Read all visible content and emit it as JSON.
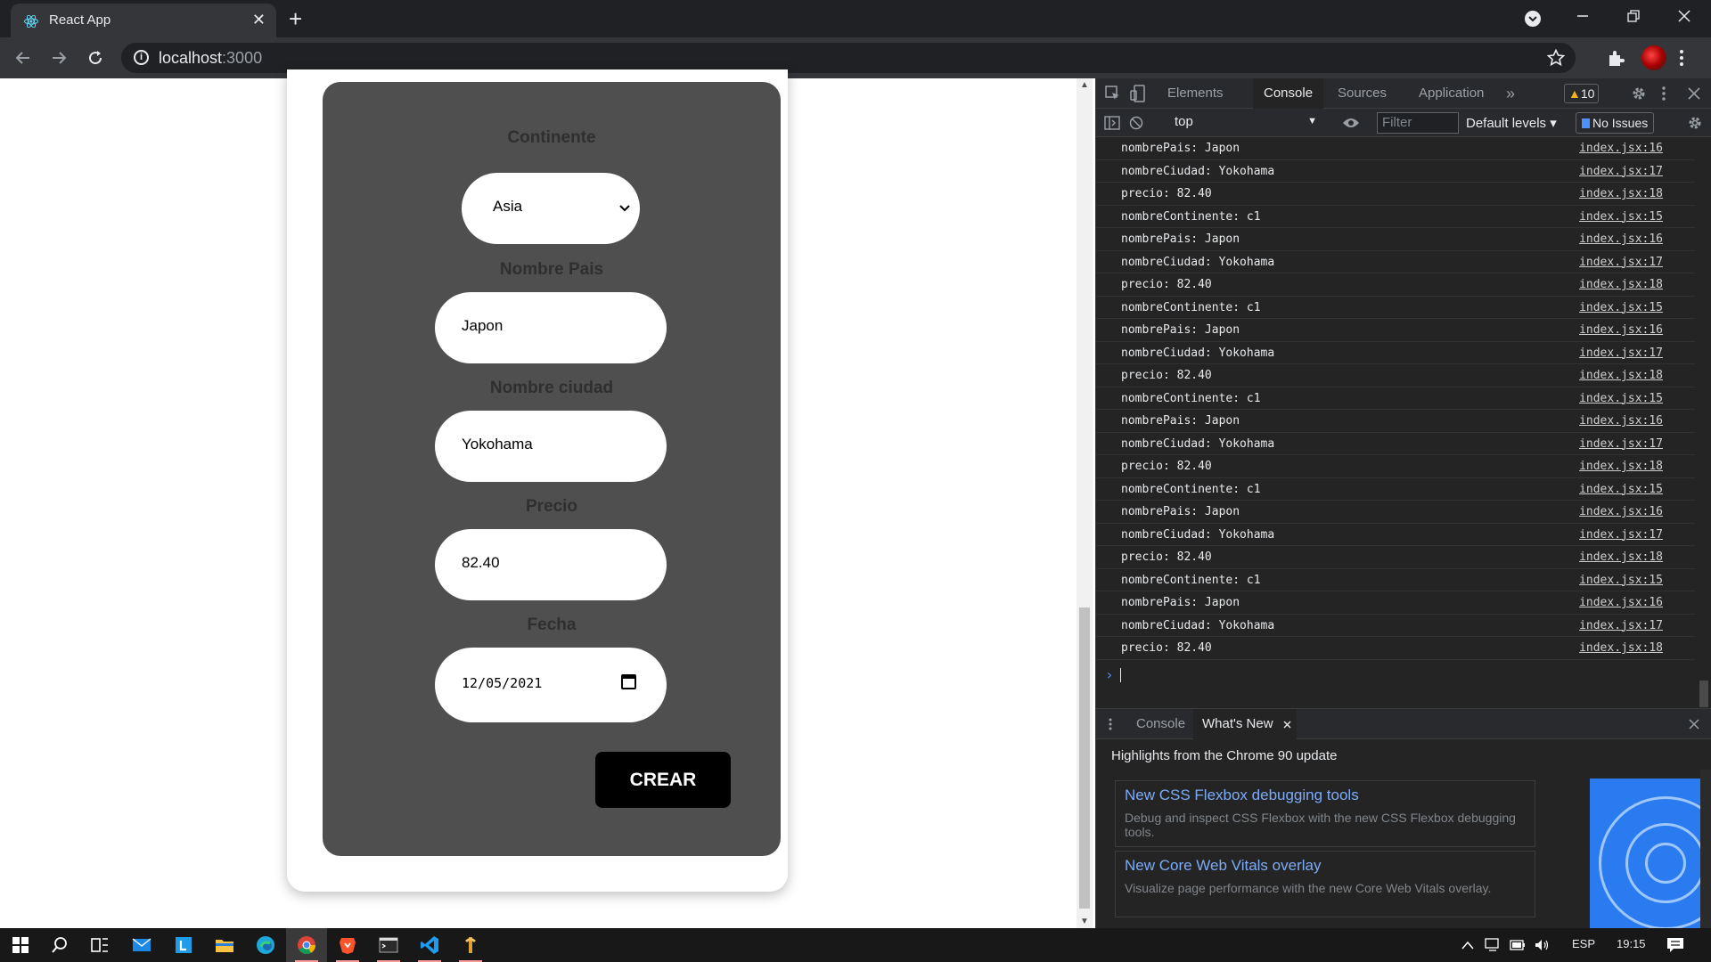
{
  "browser": {
    "tab_title": "React App",
    "tab_close": "✕",
    "new_tab": "+",
    "url_host": "localhost",
    "url_port": ":3000"
  },
  "form": {
    "continente_label": "Continente",
    "continente_value": "Asia",
    "nombre_pais_label": "Nombre Pais",
    "nombre_pais_value": "Japon",
    "nombre_ciudad_label": "Nombre ciudad",
    "nombre_ciudad_value": "Yokohama",
    "precio_label": "Precio",
    "precio_value": "82.40",
    "fecha_label": "Fecha",
    "fecha_value": "12/05/2021",
    "submit_label": "CREAR"
  },
  "devtools": {
    "tabs": [
      "Elements",
      "Console",
      "Sources",
      "Application"
    ],
    "more": "»",
    "warnings": "10",
    "context": "top",
    "filter_placeholder": "Filter",
    "levels": "Default levels",
    "issues": "No Issues",
    "log": [
      {
        "msg": "nombrePais: Japon",
        "src": "index.jsx:16"
      },
      {
        "msg": "nombreCiudad: Yokohama",
        "src": "index.jsx:17"
      },
      {
        "msg": "precio: 82.40",
        "src": "index.jsx:18"
      },
      {
        "msg": "nombreContinente: c1",
        "src": "index.jsx:15"
      },
      {
        "msg": "nombrePais: Japon",
        "src": "index.jsx:16"
      },
      {
        "msg": "nombreCiudad: Yokohama",
        "src": "index.jsx:17"
      },
      {
        "msg": "precio: 82.40",
        "src": "index.jsx:18"
      },
      {
        "msg": "nombreContinente: c1",
        "src": "index.jsx:15"
      },
      {
        "msg": "nombrePais: Japon",
        "src": "index.jsx:16"
      },
      {
        "msg": "nombreCiudad: Yokohama",
        "src": "index.jsx:17"
      },
      {
        "msg": "precio: 82.40",
        "src": "index.jsx:18"
      },
      {
        "msg": "nombreContinente: c1",
        "src": "index.jsx:15"
      },
      {
        "msg": "nombrePais: Japon",
        "src": "index.jsx:16"
      },
      {
        "msg": "nombreCiudad: Yokohama",
        "src": "index.jsx:17"
      },
      {
        "msg": "precio: 82.40",
        "src": "index.jsx:18"
      },
      {
        "msg": "nombreContinente: c1",
        "src": "index.jsx:15"
      },
      {
        "msg": "nombrePais: Japon",
        "src": "index.jsx:16"
      },
      {
        "msg": "nombreCiudad: Yokohama",
        "src": "index.jsx:17"
      },
      {
        "msg": "precio: 82.40",
        "src": "index.jsx:18"
      },
      {
        "msg": "nombreContinente: c1",
        "src": "index.jsx:15"
      },
      {
        "msg": "nombrePais: Japon",
        "src": "index.jsx:16"
      },
      {
        "msg": "nombreCiudad: Yokohama",
        "src": "index.jsx:17"
      },
      {
        "msg": "precio: 82.40",
        "src": "index.jsx:18"
      }
    ],
    "drawer_tabs": [
      "Console",
      "What's New"
    ],
    "highlights": "Highlights from the Chrome 90 update",
    "cards": [
      {
        "title": "New CSS Flexbox debugging tools",
        "desc": "Debug and inspect CSS Flexbox with the new CSS Flexbox debugging tools."
      },
      {
        "title": "New Core Web Vitals overlay",
        "desc": "Visualize page performance with the new Core Web Vitals overlay."
      }
    ]
  },
  "taskbar": {
    "lang": "ESP",
    "time": "19:15"
  },
  "colors": {
    "form_bg": "#4f4f4f",
    "submit_bg": "#000000",
    "link_blue": "#7cacf8",
    "warning": "#f2b21c"
  }
}
